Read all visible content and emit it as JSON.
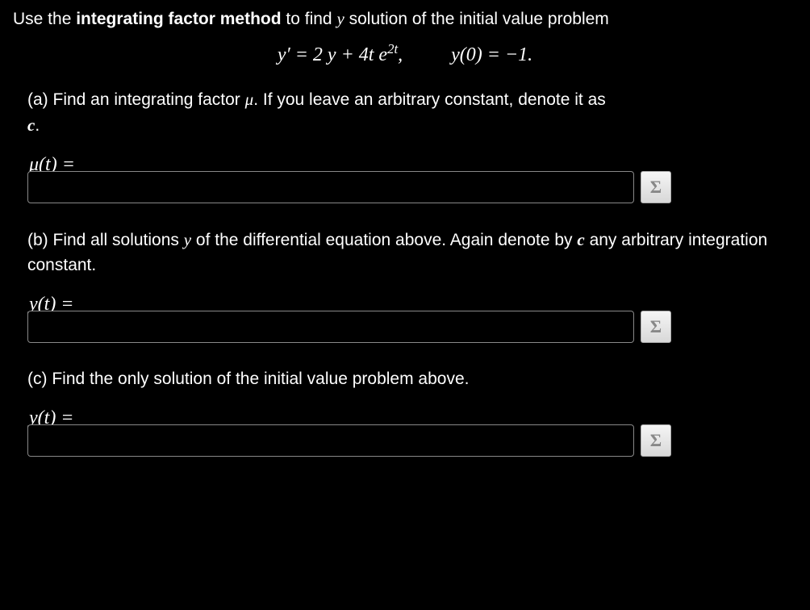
{
  "intro": {
    "pre": "Use the ",
    "method": "integrating factor method",
    "post1": " to find ",
    "var": "y",
    "post2": " solution of the initial value problem"
  },
  "equation": {
    "lhs": "y′ = 2 y + 4t e",
    "exp": "2t",
    "comma": ",",
    "rhs": "y(0) = −1."
  },
  "parts": {
    "a": {
      "text_pre": "(a) Find an integrating factor ",
      "mu": "μ",
      "text_mid": ". If you leave an arbitrary constant, denote it as ",
      "c": "c",
      "text_post": ".",
      "label": "μ(t) ="
    },
    "b": {
      "text_pre": "(b) Find all solutions ",
      "y": "y",
      "text_mid": " of the differential equation above. Again denote by ",
      "c": "c",
      "text_post": " any arbitrary integration constant.",
      "label": "y(t) ="
    },
    "c": {
      "text": "(c) Find the only solution of the initial value problem above.",
      "label": "y(t) ="
    }
  },
  "sigma": "Σ"
}
